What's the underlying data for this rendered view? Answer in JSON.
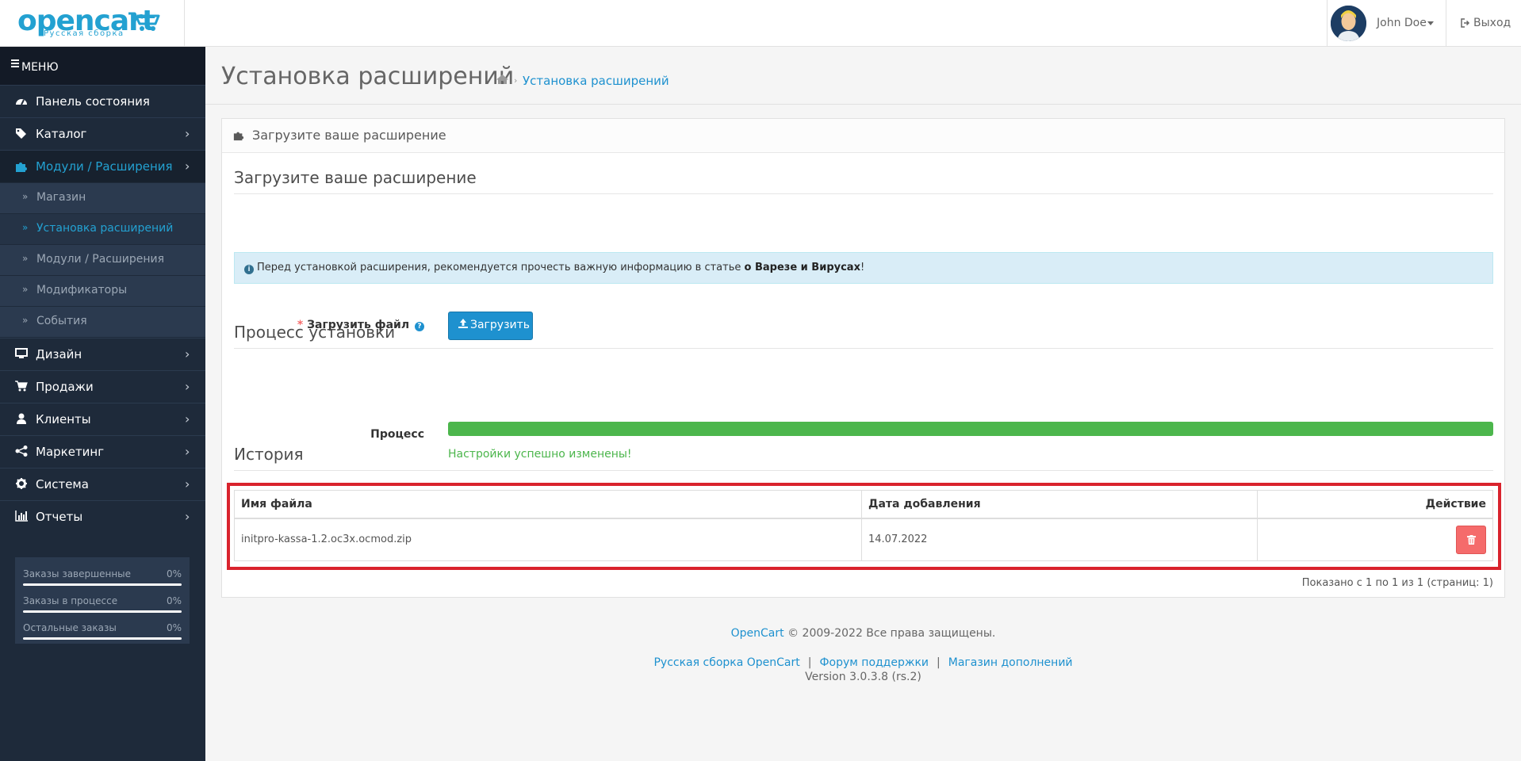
{
  "header": {
    "logo_text": "opencart",
    "logo_subtitle": "Русская сборка",
    "user_name": "John Doe",
    "logout_label": "Выход"
  },
  "sidebar": {
    "menu_title": "МЕНЮ",
    "items": [
      {
        "label": "Панель состояния",
        "icon": "dashboard-icon"
      },
      {
        "label": "Каталог",
        "icon": "tags-icon"
      },
      {
        "label": "Модули / Расширения",
        "icon": "puzzle-icon"
      },
      {
        "label": "Дизайн",
        "icon": "desktop-icon"
      },
      {
        "label": "Продажи",
        "icon": "cart-icon"
      },
      {
        "label": "Клиенты",
        "icon": "user-icon"
      },
      {
        "label": "Маркетинг",
        "icon": "share-icon"
      },
      {
        "label": "Система",
        "icon": "cog-icon"
      },
      {
        "label": "Отчеты",
        "icon": "bar-chart-icon"
      }
    ],
    "subitems": [
      {
        "label": "Магазин"
      },
      {
        "label": "Установка расширений"
      },
      {
        "label": "Модули / Расширения"
      },
      {
        "label": "Модификаторы"
      },
      {
        "label": "События"
      }
    ],
    "stats": [
      {
        "label": "Заказы завершенные",
        "percent": "0%"
      },
      {
        "label": "Заказы в процессе",
        "percent": "0%"
      },
      {
        "label": "Остальные заказы",
        "percent": "0%"
      }
    ]
  },
  "page": {
    "title": "Установка расширений",
    "breadcrumb": "Установка расширений",
    "panel_title": "Загрузите ваше расширение",
    "upload_legend": "Загрузите ваше расширение",
    "alert_text": "Перед установкой расширения, рекомендуется прочесть важную информацию в статье",
    "alert_link": "о Варезе и Вирусах",
    "alert_end": "!",
    "upload_label": "Загрузить файл",
    "upload_button": "Загрузить",
    "process_legend": "Процесс установки",
    "process_label": "Процесс",
    "progress_percent": 100,
    "progress_message": "Настройки успешно изменены!",
    "history_legend": "История",
    "history": {
      "columns": [
        "Имя файла",
        "Дата добавления",
        "Действие"
      ],
      "rows": [
        {
          "filename": "initpro-kassa-1.2.oc3x.ocmod.zip",
          "date": "14.07.2022"
        }
      ]
    },
    "pagination": "Показано с 1 по 1 из 1 (страниц: 1)"
  },
  "footer": {
    "brand": "OpenCart",
    "copyright": "© 2009-2022 Все права защищены.",
    "links": [
      "Русская сборка OpenCart",
      "Форум поддержки",
      "Магазин дополнений"
    ],
    "version": "Version 3.0.3.8 (rs.2)"
  },
  "colors": {
    "sidebar_bg": "#1e2a3a",
    "accent": "#1e91cf",
    "success": "#4cb64c",
    "danger": "#f56b6b",
    "highlight": "#d9232d"
  }
}
